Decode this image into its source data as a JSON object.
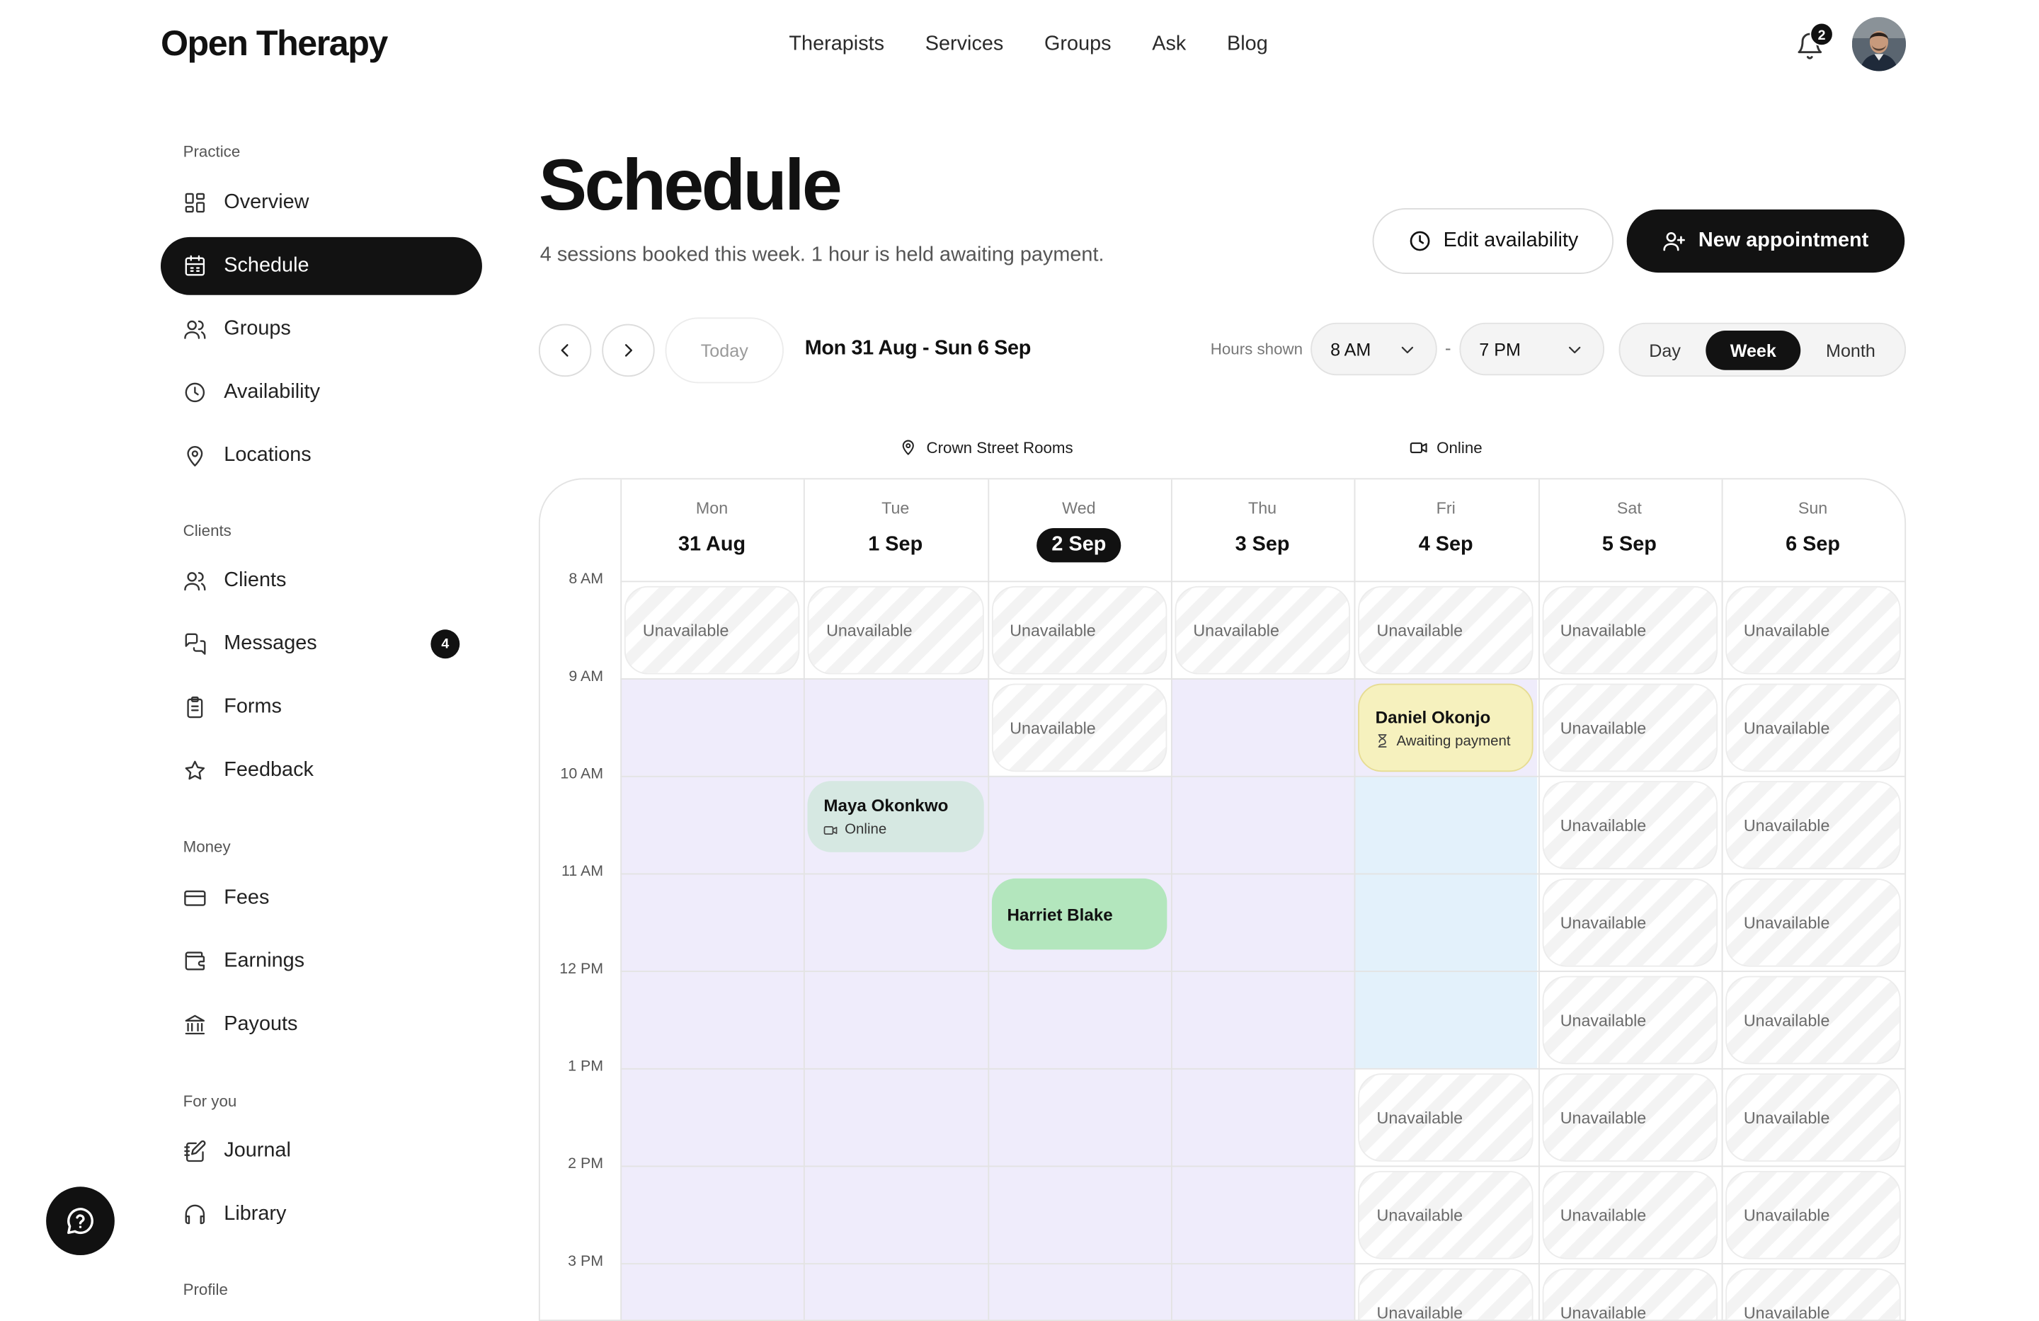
{
  "app": {
    "name": "Open Therapy"
  },
  "topnav": {
    "items": [
      "Therapists",
      "Services",
      "Groups",
      "Ask",
      "Blog"
    ],
    "notification_count": "2"
  },
  "sidebar": {
    "sections": [
      {
        "heading": "Practice",
        "items": [
          {
            "label": "Overview",
            "icon": "grid-icon"
          },
          {
            "label": "Schedule",
            "icon": "calendar-icon",
            "active": true
          },
          {
            "label": "Groups",
            "icon": "users-icon"
          },
          {
            "label": "Availability",
            "icon": "clock-icon"
          },
          {
            "label": "Locations",
            "icon": "map-pin-icon"
          }
        ]
      },
      {
        "heading": "Clients",
        "items": [
          {
            "label": "Clients",
            "icon": "users-icon"
          },
          {
            "label": "Messages",
            "icon": "chat-icon",
            "badge": "4"
          },
          {
            "label": "Forms",
            "icon": "clipboard-icon"
          },
          {
            "label": "Feedback",
            "icon": "star-icon"
          }
        ]
      },
      {
        "heading": "Money",
        "items": [
          {
            "label": "Fees",
            "icon": "credit-card-icon"
          },
          {
            "label": "Earnings",
            "icon": "wallet-icon"
          },
          {
            "label": "Payouts",
            "icon": "bank-icon"
          }
        ]
      },
      {
        "heading": "For you",
        "items": [
          {
            "label": "Journal",
            "icon": "journal-icon"
          },
          {
            "label": "Library",
            "icon": "headphones-icon"
          }
        ]
      },
      {
        "heading": "Profile",
        "items": []
      }
    ]
  },
  "page": {
    "title": "Schedule",
    "subtitle": "4 sessions booked this week. 1 hour is held awaiting payment.",
    "edit_availability": "Edit availability",
    "new_appointment": "New appointment"
  },
  "toolbar": {
    "today": "Today",
    "range": "Mon 31 Aug - Sun 6 Sep",
    "hours_label": "Hours shown",
    "start_hour": "8 AM",
    "end_hour": "7 PM",
    "dash": "-",
    "views": [
      "Day",
      "Week",
      "Month"
    ],
    "active_view": "Week"
  },
  "calendar": {
    "locations": [
      {
        "label": "Crown Street Rooms",
        "icon": "map-pin-icon",
        "color": "#ddd8f5"
      },
      {
        "label": "Online",
        "icon": "video-icon",
        "color": "#cfe6f7"
      }
    ],
    "days": [
      {
        "dow": "Mon",
        "date": "31 Aug"
      },
      {
        "dow": "Tue",
        "date": "1 Sep"
      },
      {
        "dow": "Wed",
        "date": "2 Sep",
        "today": true
      },
      {
        "dow": "Thu",
        "date": "3 Sep"
      },
      {
        "dow": "Fri",
        "date": "4 Sep"
      },
      {
        "dow": "Sat",
        "date": "5 Sep"
      },
      {
        "dow": "Sun",
        "date": "6 Sep"
      }
    ],
    "hours": [
      "8 AM",
      "9 AM",
      "10 AM",
      "11 AM",
      "12 PM",
      "1 PM",
      "2 PM",
      "3 PM"
    ],
    "unavailable_label": "Unavailable",
    "unavailable": [
      [
        0,
        0
      ],
      [
        1,
        0
      ],
      [
        2,
        0
      ],
      [
        3,
        0
      ],
      [
        4,
        0
      ],
      [
        5,
        0
      ],
      [
        6,
        0
      ],
      [
        2,
        1
      ],
      [
        5,
        1
      ],
      [
        6,
        1
      ],
      [
        5,
        2
      ],
      [
        6,
        2
      ],
      [
        5,
        3
      ],
      [
        6,
        3
      ],
      [
        5,
        4
      ],
      [
        6,
        4
      ],
      [
        4,
        5
      ],
      [
        5,
        5
      ],
      [
        6,
        5
      ],
      [
        4,
        6
      ],
      [
        5,
        6
      ],
      [
        6,
        6
      ],
      [
        4,
        7
      ],
      [
        5,
        7
      ],
      [
        6,
        7
      ]
    ],
    "online_slots": [
      [
        4,
        2
      ],
      [
        4,
        3
      ],
      [
        4,
        4
      ]
    ],
    "appointments": [
      {
        "name": "Daniel Okonjo",
        "status": "Awaiting payment",
        "status_icon": "hourglass-icon",
        "day": 4,
        "hour": 1,
        "color": "#f6f1be"
      },
      {
        "name": "Maya Okonkwo",
        "status": "Online",
        "status_icon": "video-icon",
        "day": 1,
        "hour": 2,
        "color": "#d6e8e2"
      },
      {
        "name": "Harriet Blake",
        "status": "",
        "status_icon": "",
        "day": 2,
        "hour": 3,
        "color": "#b3e6bd"
      }
    ],
    "colors": {
      "in_person_bg": "#efecfb",
      "online_bg": "#e3f1fb"
    }
  }
}
